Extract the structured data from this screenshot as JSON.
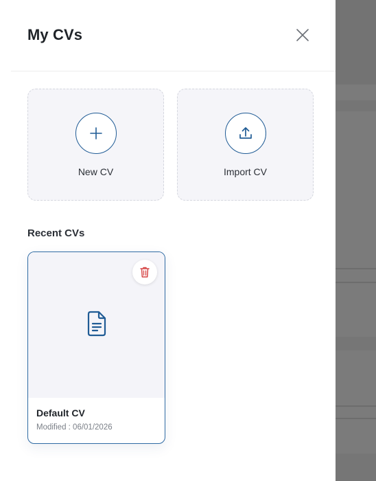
{
  "drawer": {
    "title": "My CVs",
    "close_label": "close"
  },
  "actions": {
    "new_cv_label": "New CV",
    "import_cv_label": "Import CV"
  },
  "recent": {
    "title": "Recent CVs",
    "items": [
      {
        "name": "Default CV",
        "modified": "Modified : 06/01/2026"
      }
    ]
  },
  "icons": {
    "close": "close-icon",
    "new": "plus-icon",
    "import": "upload-icon",
    "document": "document-icon",
    "delete": "trash-icon"
  },
  "colors": {
    "accent": "#1f5b95",
    "delete": "#d64545",
    "tile_background": "#f5f5f9",
    "overlay": "#7b7b7b"
  }
}
